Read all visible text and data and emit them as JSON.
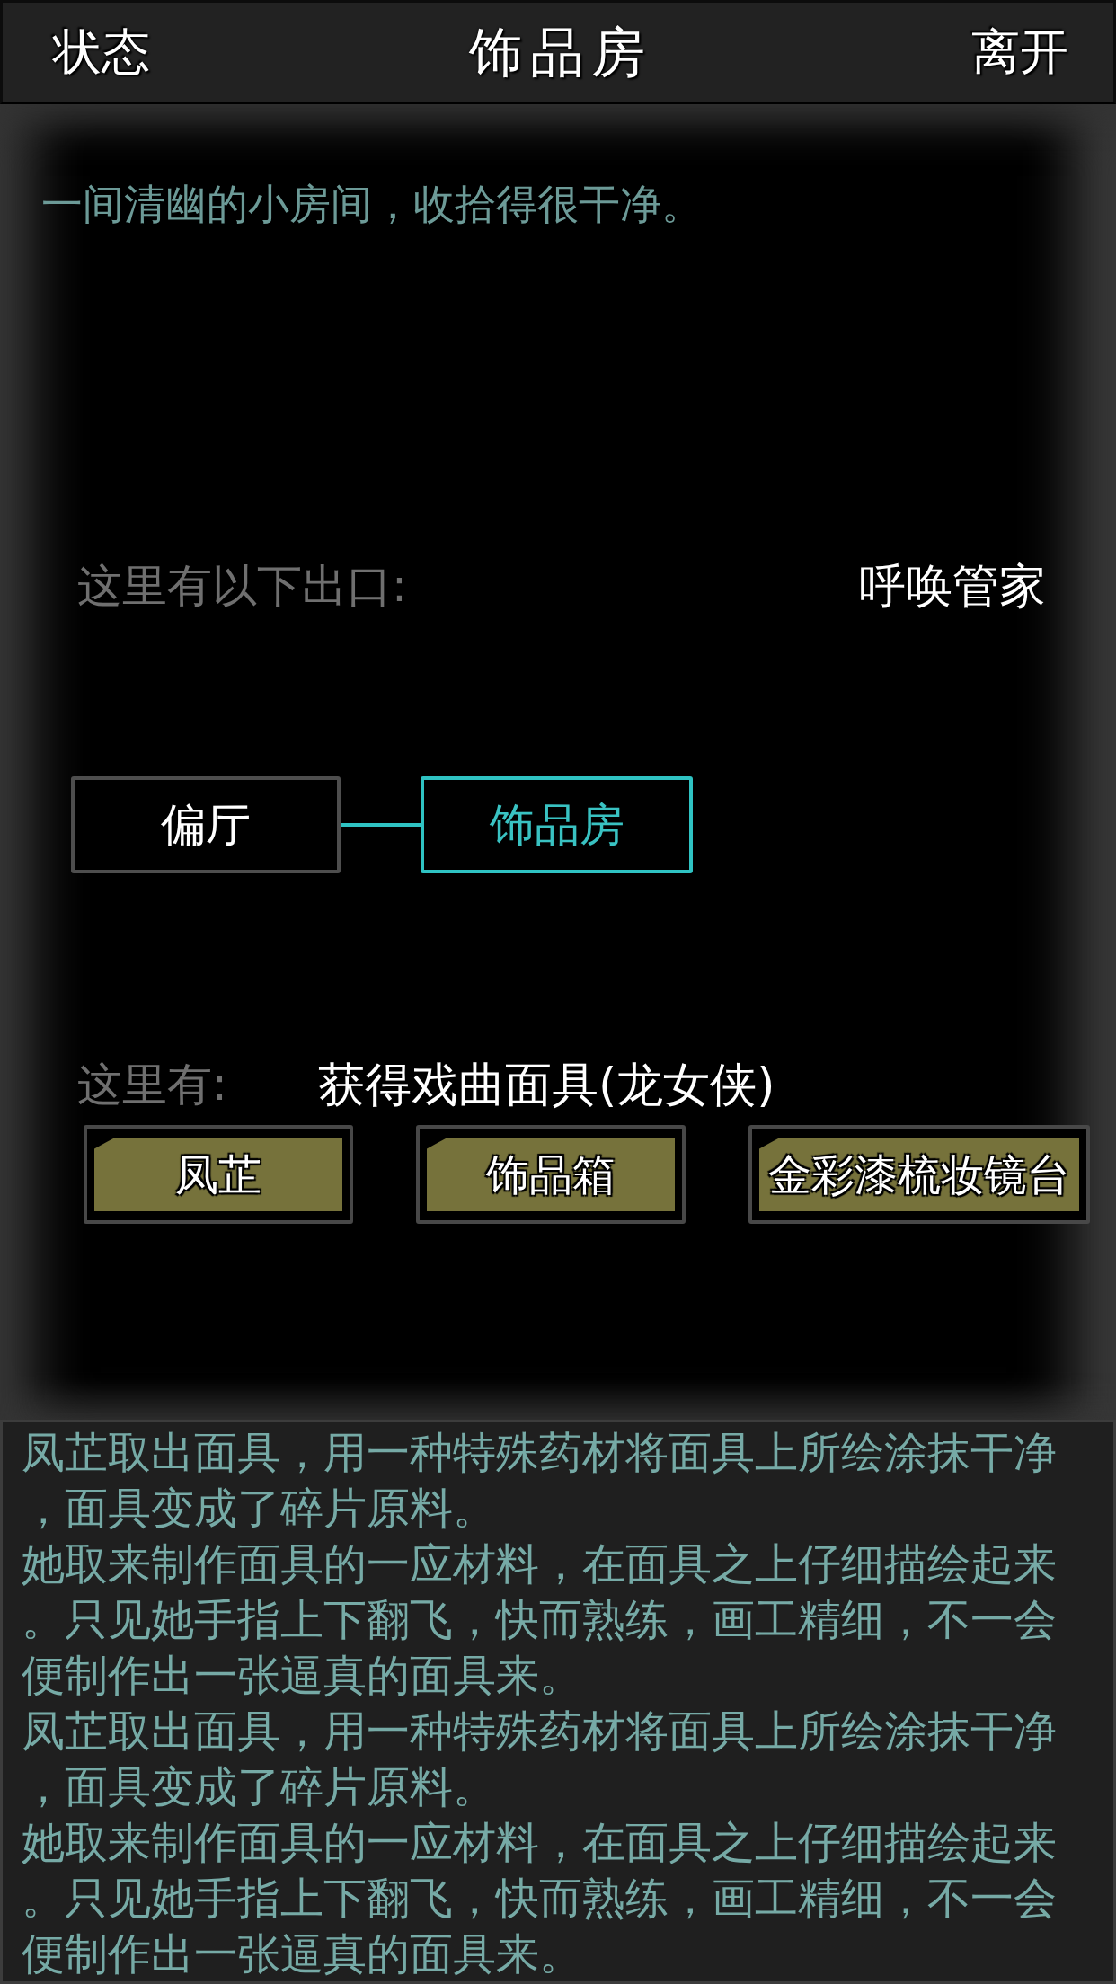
{
  "top_bar": {
    "left_button": "状态",
    "title": "饰品房",
    "right_button": "离开"
  },
  "room": {
    "description": "一间清幽的小房间，收拾得很干净。",
    "exits_label": "这里有以下出口:",
    "action": "呼唤管家"
  },
  "map": {
    "rooms": [
      {
        "name": "偏厅",
        "selected": false
      },
      {
        "name": "饰品房",
        "selected": true
      }
    ]
  },
  "here": {
    "label": "这里有:",
    "item": "获得戏曲面具(龙女侠)",
    "objects": [
      "凤芷",
      "饰品箱",
      "金彩漆梳妆镜台"
    ]
  },
  "log": {
    "entries": [
      "凤芷取出面具，用一种特殊药材将面具上所绘涂抹干净，面具变成了碎片原料。",
      "她取来制作面具的一应材料，在面具之上仔细描绘起来。只见她手指上下翻飞，快而熟练，画工精细，不一会便制作出一张逼真的面具来。",
      "凤芷取出面具，用一种特殊药材将面具上所绘涂抹干净，面具变成了碎片原料。",
      "她取来制作面具的一应材料，在面具之上仔细描绘起来。只见她手指上下翻飞，快而熟练，画工精细，不一会便制作出一张逼真的面具来。"
    ]
  }
}
